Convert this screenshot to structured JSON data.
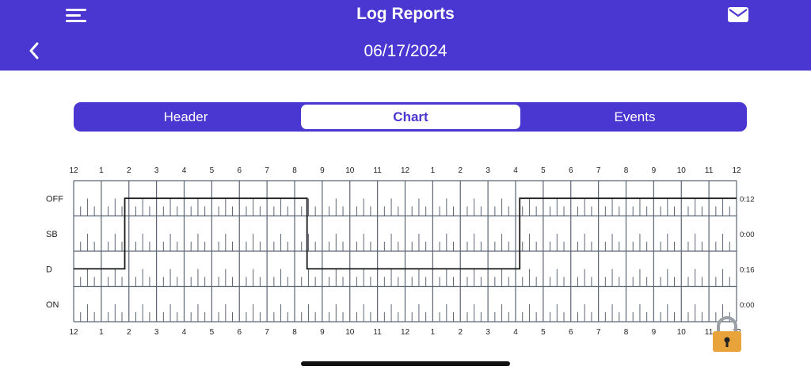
{
  "header": {
    "title": "Log Reports",
    "date": "06/17/2024",
    "menu_icon": "hamburger-menu-icon",
    "mail_icon": "mail-icon",
    "back_icon": "chevron-left-icon"
  },
  "tabs": [
    {
      "label": "Header",
      "active": false
    },
    {
      "label": "Chart",
      "active": true
    },
    {
      "label": "Events",
      "active": false
    }
  ],
  "colors": {
    "brand": "#4a36d1",
    "grid": "#5b6673",
    "trace": "#1a1a1a",
    "lock": "#e8a33a"
  },
  "chart_data": {
    "type": "line",
    "hour_labels": [
      "12",
      "1",
      "2",
      "3",
      "4",
      "5",
      "6",
      "7",
      "8",
      "9",
      "10",
      "11",
      "12",
      "1",
      "2",
      "3",
      "4",
      "5",
      "6",
      "7",
      "8",
      "9",
      "10",
      "11",
      "12"
    ],
    "rows": [
      "OFF",
      "SB",
      "D",
      "ON"
    ],
    "totals": [
      "0:12",
      "0:00",
      "0:16",
      "0:00"
    ],
    "segments": [
      {
        "status": "D",
        "start": 0,
        "end": 1.85
      },
      {
        "status": "OFF",
        "start": 1.85,
        "end": 8.45
      },
      {
        "status": "D",
        "start": 8.45,
        "end": 16.15
      },
      {
        "status": "OFF",
        "start": 16.15,
        "end": 24
      }
    ]
  },
  "lock_icon": "padlock-icon"
}
